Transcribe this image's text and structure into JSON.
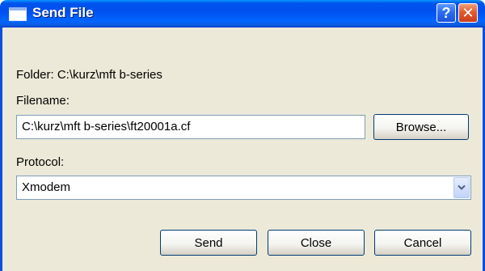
{
  "window": {
    "title": "Send File",
    "help_glyph": "?",
    "close_glyph": "✕"
  },
  "folder": {
    "text": "Folder:  C:\\kurz\\mft b-series"
  },
  "filename": {
    "label": "Filename:",
    "value": "C:\\kurz\\mft b-series\\ft20001a.cf",
    "browse_label": "Browse..."
  },
  "protocol": {
    "label": "Protocol:",
    "selected": "Xmodem"
  },
  "buttons": {
    "send": "Send",
    "close": "Close",
    "cancel": "Cancel"
  },
  "icons": {
    "window_icon": "window-icon",
    "help": "help-icon",
    "close": "close-icon",
    "dropdown": "chevron-down-icon"
  },
  "colors": {
    "titlebar": "#0054e3",
    "dialog_bg": "#ece9d8",
    "close_button": "#e4592c"
  }
}
